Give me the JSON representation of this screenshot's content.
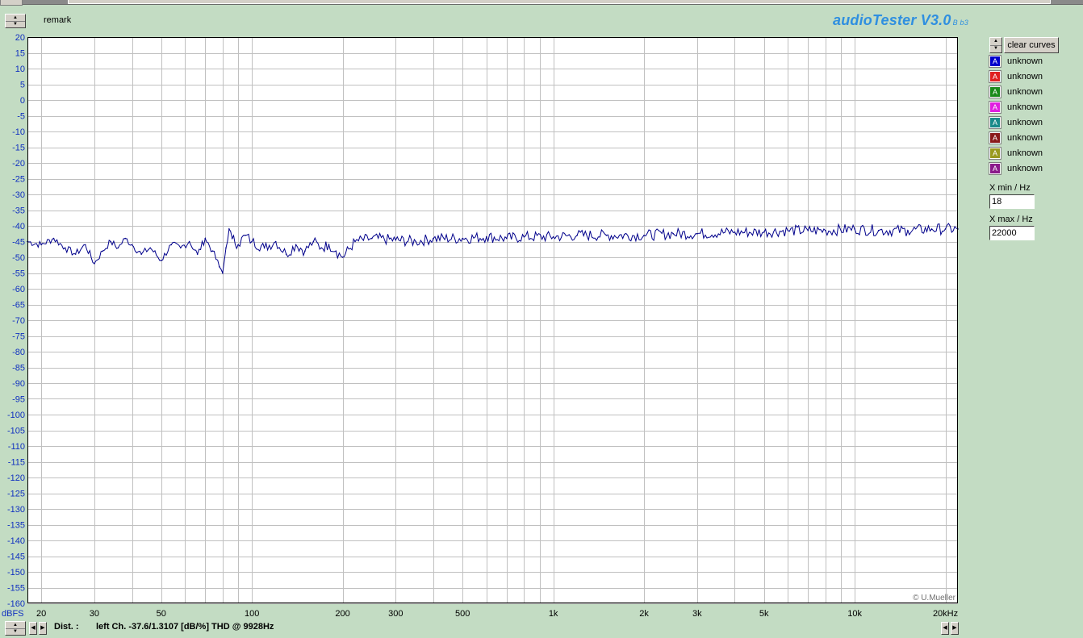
{
  "header": {
    "remark_label": "remark",
    "brand": "audioTester V3.0",
    "brand_version": "B b3"
  },
  "sidebar": {
    "clear_button": "clear curves",
    "curves": [
      {
        "label": "unknown",
        "color": "#0000cc",
        "mark": "A"
      },
      {
        "label": "unknown",
        "color": "#e02020",
        "mark": "A"
      },
      {
        "label": "unknown",
        "color": "#1a8a1a",
        "mark": "A"
      },
      {
        "label": "unknown",
        "color": "#e020e0",
        "mark": "A"
      },
      {
        "label": "unknown",
        "color": "#1a8a8a",
        "mark": "A"
      },
      {
        "label": "unknown",
        "color": "#8a1a1a",
        "mark": "A"
      },
      {
        "label": "unknown",
        "color": "#9a9a20",
        "mark": "A"
      },
      {
        "label": "unknown",
        "color": "#8a1a8a",
        "mark": "A"
      }
    ],
    "xmin_label": "X min / Hz",
    "xmin_value": "18",
    "xmax_label": "X max / Hz",
    "xmax_value": "22000"
  },
  "footer": {
    "dist_label": "Dist. :",
    "status": "left Ch. -37.6/1.3107 [dB/%] THD @ 9928Hz"
  },
  "chart_data": {
    "type": "line",
    "x_scale": "log",
    "xlim": [
      18,
      22000
    ],
    "ylim": [
      -160,
      20
    ],
    "ylabel": "dBFS",
    "copyright": "© U.Mueller",
    "grid": true,
    "y_ticks": [
      20,
      15,
      10,
      5,
      0,
      -5,
      -10,
      -15,
      -20,
      -25,
      -30,
      -35,
      -40,
      -45,
      -50,
      -55,
      -60,
      -65,
      -70,
      -75,
      -80,
      -85,
      -90,
      -95,
      -100,
      -105,
      -110,
      -115,
      -120,
      -125,
      -130,
      -135,
      -140,
      -145,
      -150,
      -155,
      -160
    ],
    "x_tick_labels": [
      {
        "v": 20,
        "t": "20"
      },
      {
        "v": 30,
        "t": "30"
      },
      {
        "v": 50,
        "t": "50"
      },
      {
        "v": 100,
        "t": "100"
      },
      {
        "v": 200,
        "t": "200"
      },
      {
        "v": 300,
        "t": "300"
      },
      {
        "v": 500,
        "t": "500"
      },
      {
        "v": 1000,
        "t": "1k"
      },
      {
        "v": 2000,
        "t": "2k"
      },
      {
        "v": 3000,
        "t": "3k"
      },
      {
        "v": 5000,
        "t": "5k"
      },
      {
        "v": 10000,
        "t": "10k"
      },
      {
        "v": 20000,
        "t": "20kHz"
      }
    ],
    "series": [
      {
        "color": "#00008b",
        "x": [
          18,
          20,
          22,
          24,
          26,
          28,
          30,
          32,
          34,
          36,
          38,
          40,
          43,
          46,
          50,
          54,
          58,
          62,
          66,
          70,
          74,
          78,
          80,
          82,
          84,
          86,
          90,
          95,
          100,
          110,
          120,
          130,
          140,
          150,
          160,
          170,
          180,
          190,
          200,
          220,
          250,
          300,
          350,
          400,
          500,
          600,
          700,
          800,
          1000,
          1200,
          1500,
          2000,
          2500,
          3000,
          4000,
          5000,
          6000,
          7000,
          8000,
          10000,
          12000,
          15000,
          18000,
          20000,
          22000
        ],
        "y": [
          -45,
          -46,
          -44,
          -47,
          -49,
          -46,
          -52,
          -48,
          -45,
          -47,
          -44,
          -46,
          -49,
          -47,
          -51,
          -46,
          -47,
          -45,
          -49,
          -44,
          -48,
          -53,
          -55,
          -47,
          -41,
          -44,
          -46,
          -43,
          -45,
          -47,
          -45,
          -49,
          -46,
          -48,
          -45,
          -47,
          -46,
          -48,
          -50,
          -45,
          -44,
          -44.5,
          -45,
          -44,
          -44,
          -43.5,
          -44,
          -43.5,
          -43.5,
          -43,
          -43,
          -43,
          -42.5,
          -42.5,
          -42,
          -42,
          -41.5,
          -41.5,
          -41.5,
          -41,
          -41.5,
          -41.5,
          -41,
          -41,
          -41
        ]
      }
    ]
  }
}
